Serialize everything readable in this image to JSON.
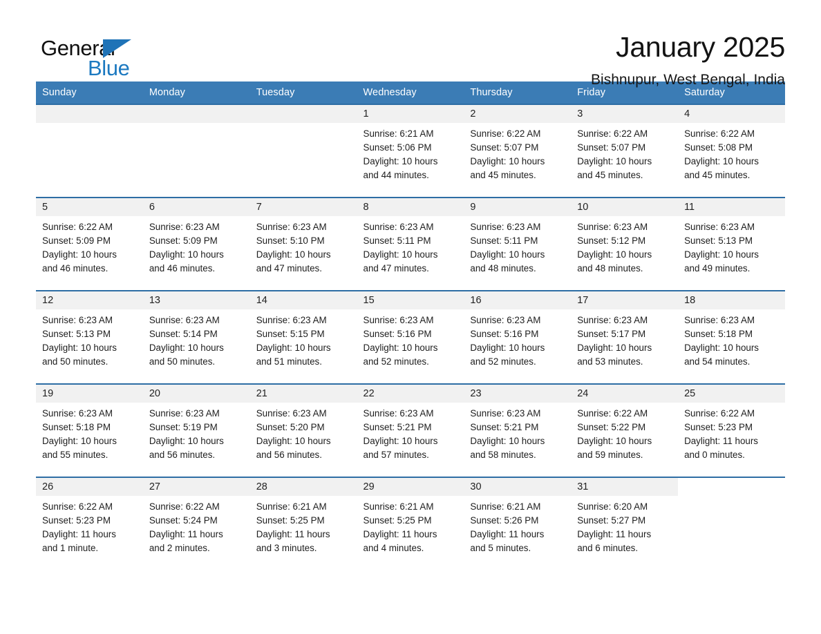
{
  "logo": {
    "word_one": "General",
    "word_two": "Blue",
    "triangle_icon": "triangle-icon",
    "brand_color": "#1c79c0"
  },
  "header": {
    "title": "January 2025",
    "location": "Bishnupur, West Bengal, India"
  },
  "theme": {
    "header_bg": "#3b7cb5",
    "row_rule": "#2d6da4",
    "daynum_bg": "#f1f1f1",
    "text": "#1d1d1d"
  },
  "calendar": {
    "weekday_headers": [
      "Sunday",
      "Monday",
      "Tuesday",
      "Wednesday",
      "Thursday",
      "Friday",
      "Saturday"
    ],
    "labels": {
      "sunrise": "Sunrise:",
      "sunset": "Sunset:",
      "daylight": "Daylight:"
    },
    "weeks": [
      [
        {
          "day": "",
          "lines": []
        },
        {
          "day": "",
          "lines": []
        },
        {
          "day": "",
          "lines": []
        },
        {
          "day": "1",
          "lines": [
            "Sunrise: 6:21 AM",
            "Sunset: 5:06 PM",
            "Daylight: 10 hours",
            "and 44 minutes."
          ]
        },
        {
          "day": "2",
          "lines": [
            "Sunrise: 6:22 AM",
            "Sunset: 5:07 PM",
            "Daylight: 10 hours",
            "and 45 minutes."
          ]
        },
        {
          "day": "3",
          "lines": [
            "Sunrise: 6:22 AM",
            "Sunset: 5:07 PM",
            "Daylight: 10 hours",
            "and 45 minutes."
          ]
        },
        {
          "day": "4",
          "lines": [
            "Sunrise: 6:22 AM",
            "Sunset: 5:08 PM",
            "Daylight: 10 hours",
            "and 45 minutes."
          ]
        }
      ],
      [
        {
          "day": "5",
          "lines": [
            "Sunrise: 6:22 AM",
            "Sunset: 5:09 PM",
            "Daylight: 10 hours",
            "and 46 minutes."
          ]
        },
        {
          "day": "6",
          "lines": [
            "Sunrise: 6:23 AM",
            "Sunset: 5:09 PM",
            "Daylight: 10 hours",
            "and 46 minutes."
          ]
        },
        {
          "day": "7",
          "lines": [
            "Sunrise: 6:23 AM",
            "Sunset: 5:10 PM",
            "Daylight: 10 hours",
            "and 47 minutes."
          ]
        },
        {
          "day": "8",
          "lines": [
            "Sunrise: 6:23 AM",
            "Sunset: 5:11 PM",
            "Daylight: 10 hours",
            "and 47 minutes."
          ]
        },
        {
          "day": "9",
          "lines": [
            "Sunrise: 6:23 AM",
            "Sunset: 5:11 PM",
            "Daylight: 10 hours",
            "and 48 minutes."
          ]
        },
        {
          "day": "10",
          "lines": [
            "Sunrise: 6:23 AM",
            "Sunset: 5:12 PM",
            "Daylight: 10 hours",
            "and 48 minutes."
          ]
        },
        {
          "day": "11",
          "lines": [
            "Sunrise: 6:23 AM",
            "Sunset: 5:13 PM",
            "Daylight: 10 hours",
            "and 49 minutes."
          ]
        }
      ],
      [
        {
          "day": "12",
          "lines": [
            "Sunrise: 6:23 AM",
            "Sunset: 5:13 PM",
            "Daylight: 10 hours",
            "and 50 minutes."
          ]
        },
        {
          "day": "13",
          "lines": [
            "Sunrise: 6:23 AM",
            "Sunset: 5:14 PM",
            "Daylight: 10 hours",
            "and 50 minutes."
          ]
        },
        {
          "day": "14",
          "lines": [
            "Sunrise: 6:23 AM",
            "Sunset: 5:15 PM",
            "Daylight: 10 hours",
            "and 51 minutes."
          ]
        },
        {
          "day": "15",
          "lines": [
            "Sunrise: 6:23 AM",
            "Sunset: 5:16 PM",
            "Daylight: 10 hours",
            "and 52 minutes."
          ]
        },
        {
          "day": "16",
          "lines": [
            "Sunrise: 6:23 AM",
            "Sunset: 5:16 PM",
            "Daylight: 10 hours",
            "and 52 minutes."
          ]
        },
        {
          "day": "17",
          "lines": [
            "Sunrise: 6:23 AM",
            "Sunset: 5:17 PM",
            "Daylight: 10 hours",
            "and 53 minutes."
          ]
        },
        {
          "day": "18",
          "lines": [
            "Sunrise: 6:23 AM",
            "Sunset: 5:18 PM",
            "Daylight: 10 hours",
            "and 54 minutes."
          ]
        }
      ],
      [
        {
          "day": "19",
          "lines": [
            "Sunrise: 6:23 AM",
            "Sunset: 5:18 PM",
            "Daylight: 10 hours",
            "and 55 minutes."
          ]
        },
        {
          "day": "20",
          "lines": [
            "Sunrise: 6:23 AM",
            "Sunset: 5:19 PM",
            "Daylight: 10 hours",
            "and 56 minutes."
          ]
        },
        {
          "day": "21",
          "lines": [
            "Sunrise: 6:23 AM",
            "Sunset: 5:20 PM",
            "Daylight: 10 hours",
            "and 56 minutes."
          ]
        },
        {
          "day": "22",
          "lines": [
            "Sunrise: 6:23 AM",
            "Sunset: 5:21 PM",
            "Daylight: 10 hours",
            "and 57 minutes."
          ]
        },
        {
          "day": "23",
          "lines": [
            "Sunrise: 6:23 AM",
            "Sunset: 5:21 PM",
            "Daylight: 10 hours",
            "and 58 minutes."
          ]
        },
        {
          "day": "24",
          "lines": [
            "Sunrise: 6:22 AM",
            "Sunset: 5:22 PM",
            "Daylight: 10 hours",
            "and 59 minutes."
          ]
        },
        {
          "day": "25",
          "lines": [
            "Sunrise: 6:22 AM",
            "Sunset: 5:23 PM",
            "Daylight: 11 hours",
            "and 0 minutes."
          ]
        }
      ],
      [
        {
          "day": "26",
          "lines": [
            "Sunrise: 6:22 AM",
            "Sunset: 5:23 PM",
            "Daylight: 11 hours",
            "and 1 minute."
          ]
        },
        {
          "day": "27",
          "lines": [
            "Sunrise: 6:22 AM",
            "Sunset: 5:24 PM",
            "Daylight: 11 hours",
            "and 2 minutes."
          ]
        },
        {
          "day": "28",
          "lines": [
            "Sunrise: 6:21 AM",
            "Sunset: 5:25 PM",
            "Daylight: 11 hours",
            "and 3 minutes."
          ]
        },
        {
          "day": "29",
          "lines": [
            "Sunrise: 6:21 AM",
            "Sunset: 5:25 PM",
            "Daylight: 11 hours",
            "and 4 minutes."
          ]
        },
        {
          "day": "30",
          "lines": [
            "Sunrise: 6:21 AM",
            "Sunset: 5:26 PM",
            "Daylight: 11 hours",
            "and 5 minutes."
          ]
        },
        {
          "day": "31",
          "lines": [
            "Sunrise: 6:20 AM",
            "Sunset: 5:27 PM",
            "Daylight: 11 hours",
            "and 6 minutes."
          ]
        },
        {
          "day": "",
          "lines": []
        }
      ]
    ]
  }
}
